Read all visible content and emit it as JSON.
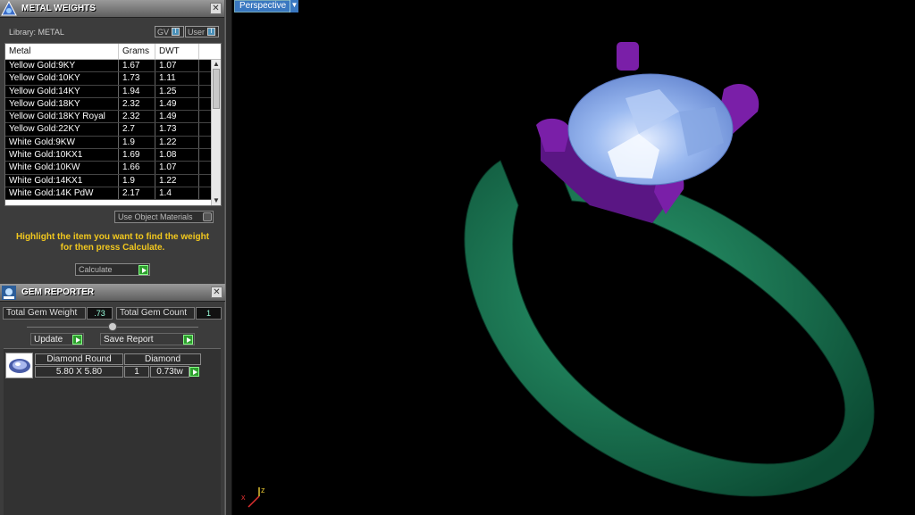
{
  "metal_panel": {
    "title": "METAL WEIGHTS",
    "library_label": "Library: METAL",
    "gv_label": "GV",
    "user_label": "User",
    "columns": [
      "Metal",
      "Grams",
      "DWT"
    ],
    "rows": [
      [
        "Yellow Gold:9KY",
        "1.67",
        "1.07"
      ],
      [
        "Yellow Gold:10KY",
        "1.73",
        "1.11"
      ],
      [
        "Yellow Gold:14KY",
        "1.94",
        "1.25"
      ],
      [
        "Yellow Gold:18KY",
        "2.32",
        "1.49"
      ],
      [
        "Yellow Gold:18KY Royal",
        "2.32",
        "1.49"
      ],
      [
        "Yellow Gold:22KY",
        "2.7",
        "1.73"
      ],
      [
        "White Gold:9KW",
        "1.9",
        "1.22"
      ],
      [
        "White Gold:10KX1",
        "1.69",
        "1.08"
      ],
      [
        "White Gold:10KW",
        "1.66",
        "1.07"
      ],
      [
        "White Gold:14KX1",
        "1.9",
        "1.22"
      ],
      [
        "White Gold:14K PdW",
        "2.17",
        "1.4"
      ]
    ],
    "use_object_materials": "Use Object Materials",
    "hint_line1": "Highlight the item you want to find the weight",
    "hint_line2": "for then press Calculate.",
    "calculate": "Calculate"
  },
  "gem_panel": {
    "title": "GEM REPORTER",
    "total_weight_label": "Total Gem Weight",
    "total_weight_value": ".73",
    "total_count_label": "Total Gem Count",
    "total_count_value": "1",
    "update": "Update",
    "save_report": "Save Report",
    "gem": {
      "shape": "Diamond Round",
      "material": "Diamond",
      "size": "5.80 X 5.80",
      "count": "1",
      "weight": "0.73tw"
    }
  },
  "viewport": {
    "view_label": "Perspective",
    "axis_x": "x",
    "axis_z": "z",
    "colors": {
      "band": "#1d7a55",
      "prongs": "#7a1fa8",
      "stone": "#8eb4ef"
    }
  }
}
